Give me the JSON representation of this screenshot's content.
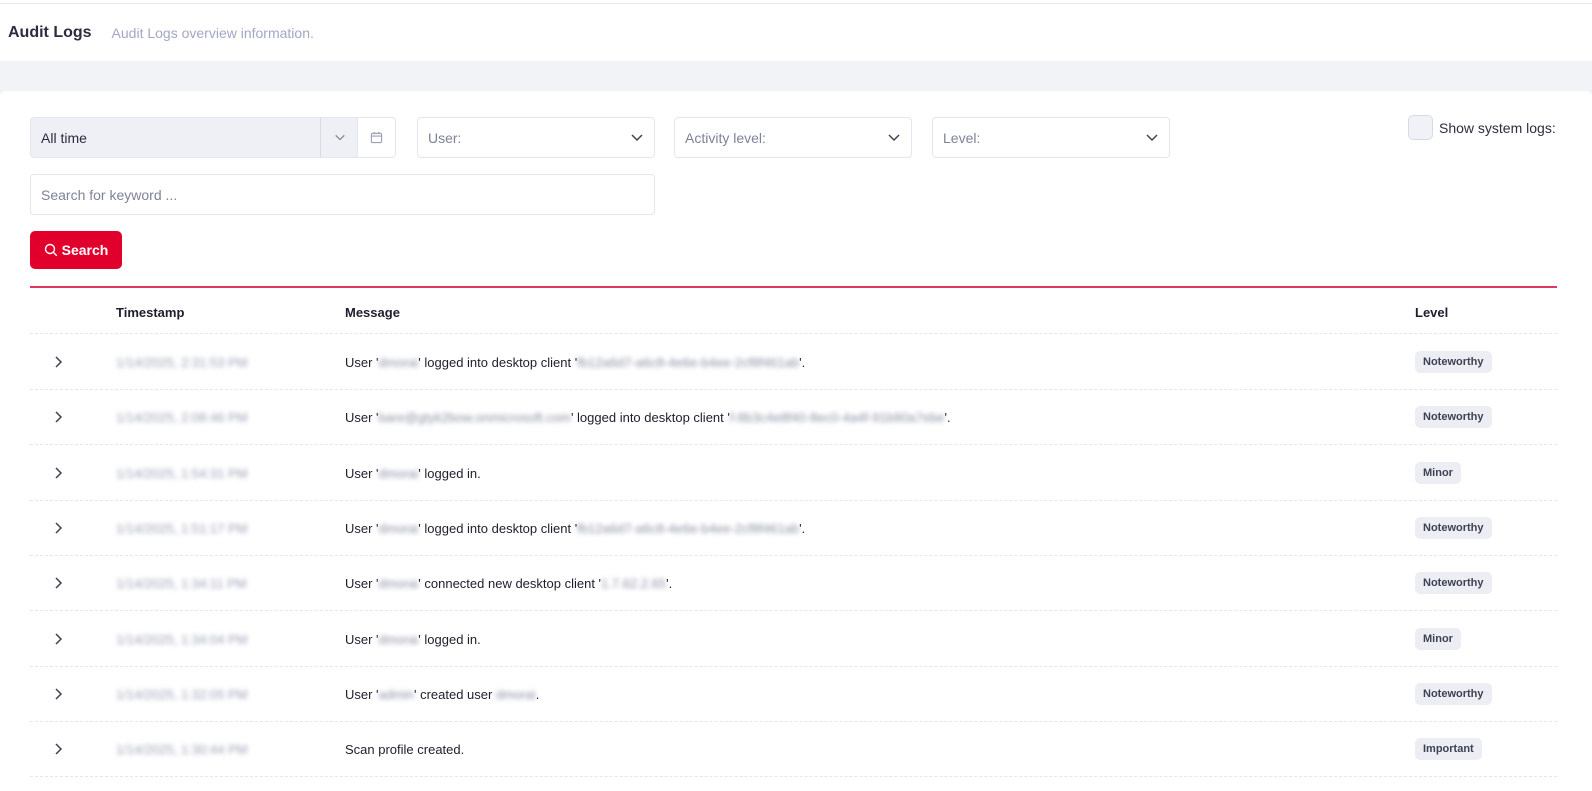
{
  "header": {
    "title": "Audit Logs",
    "subtitle": "Audit Logs overview information."
  },
  "filters": {
    "time_range": "All time",
    "user_placeholder": "User:",
    "activity_level_placeholder": "Activity level:",
    "level_placeholder": "Level:",
    "show_system_logs_label": "Show system logs:",
    "search_placeholder": "Search for keyword ...",
    "search_button": "Search"
  },
  "table": {
    "columns": {
      "timestamp": "Timestamp",
      "message": "Message",
      "level": "Level"
    },
    "rows": [
      {
        "timestamp": "1/14/2025, 2:31:53 PM",
        "pre": "User '",
        "u1": "dmorai",
        "mid": "' logged into desktop client '",
        "u2": "fb12a6d7-a6c8-4e6e-b4ee-2cf8f461ab",
        "post": "'.",
        "level": "Noteworthy"
      },
      {
        "timestamp": "1/14/2025, 2:08:46 PM",
        "pre": "User '",
        "u1": "bare@gtyk2bow.onmicrosoft.com",
        "mid": "' logged into desktop client '",
        "u2": "f-8b3c4e8f40-8ec0-4a4f-91b90a7ebe",
        "post": "'.",
        "level": "Noteworthy"
      },
      {
        "timestamp": "1/14/2025, 1:54:31 PM",
        "pre": "User '",
        "u1": "dmorai",
        "mid": "' logged in.",
        "u2": "",
        "post": "",
        "level": "Minor"
      },
      {
        "timestamp": "1/14/2025, 1:51:17 PM",
        "pre": "User '",
        "u1": "dmorai",
        "mid": "' logged into desktop client '",
        "u2": "fb12a6d7-a6c8-4e6e-b4ee-2cf8f461ab",
        "post": "'.",
        "level": "Noteworthy"
      },
      {
        "timestamp": "1/14/2025, 1:34:11 PM",
        "pre": "User '",
        "u1": "dmorai",
        "mid": "' connected new desktop client '",
        "u2": "1.7.62.2.65",
        "post": "'.",
        "level": "Noteworthy"
      },
      {
        "timestamp": "1/14/2025, 1:34:04 PM",
        "pre": "User '",
        "u1": "dmorai",
        "mid": "' logged in.",
        "u2": "",
        "post": "",
        "level": "Minor"
      },
      {
        "timestamp": "1/14/2025, 1:32:05 PM",
        "pre": "User '",
        "u1": "admin",
        "mid": "' created user ",
        "u2": "dmorai",
        "post": ".",
        "level": "Noteworthy"
      },
      {
        "timestamp": "1/14/2025, 1:30:44 PM",
        "pre": "Scan profile created.",
        "u1": "",
        "mid": "",
        "u2": "",
        "post": "",
        "level": "Important"
      }
    ]
  },
  "colors": {
    "accent": "#e1002c",
    "divider": "#e0385a"
  },
  "icons": {
    "expand": "chevron-right-icon",
    "dropdown": "chevron-down-icon",
    "calendar": "calendar-icon",
    "search": "search-icon"
  }
}
